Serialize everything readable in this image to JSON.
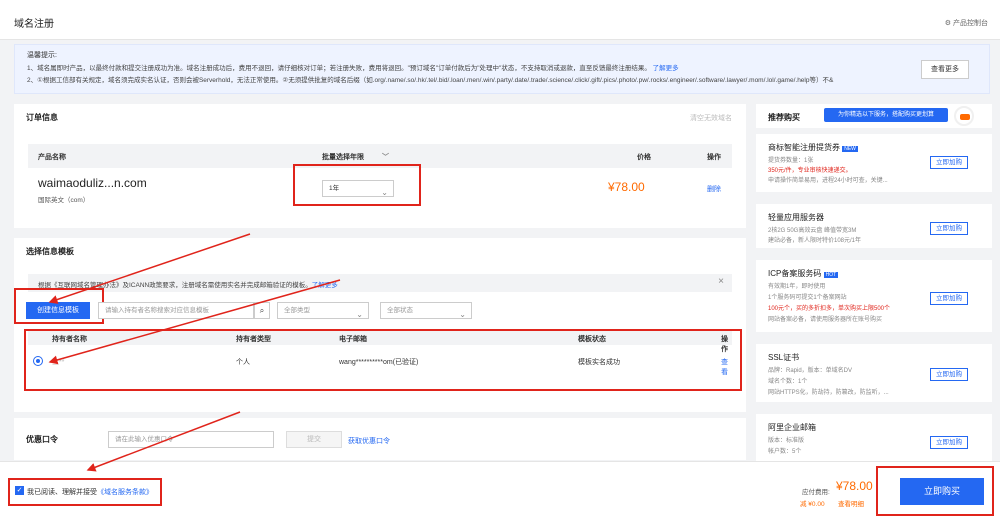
{
  "header": {
    "title": "域名注册",
    "console": "产品控制台"
  },
  "notice": {
    "title": "温馨提示:",
    "line1": "1、域名属即时产品，以最终付款和提交注册成功为准。域名注册成功后，费用不退回，请仔细核对订单；若注册失败，费用将退回。\"预订域名\"订单付款后为\"处理中\"状态，不支持取消或退款，直至反馈最终注册结果。",
    "line1_link": "了解更多",
    "line2": "2、①根据工信部有关规定，域名须完成实名认证，否则会被Serverhold，无法正常使用。②无须提供批复的域名后缀（如.org/.name/.so/.hk/.tel/.bid/.loan/.men/.win/.party/.date/.trade/.science/.click/.gift/.pics/.photo/.pw/.rocks/.engineer/.software/.lawyer/.mom/.lol/.game/.help等）不&",
    "more_button": "查看更多"
  },
  "order": {
    "title": "订单信息",
    "clear": "清空无效域名",
    "col_product": "产品名称",
    "col_years": "批量选择年限",
    "col_price": "价格",
    "col_op": "操作",
    "domain": "waimaoduliz...n.com",
    "domain_type": "国际英文（com）",
    "years": "1年",
    "price": "¥78.00",
    "delete": "删除"
  },
  "template": {
    "title": "选择信息模板",
    "info": "根据《互联网域名管理办法》及ICANN政策要求，注册域名需使用实名并完成邮箱验证的模板。",
    "info_link": "了解更多",
    "create_button": "创建信息模板",
    "search_placeholder": "请输入持有者名称搜索对应信息模板",
    "type_select": "全部类型",
    "status_select": "全部状态",
    "col_holder": "持有者名称",
    "col_type": "持有者类型",
    "col_email": "电子邮箱",
    "col_status": "模板状态",
    "col_op": "操作",
    "row": {
      "holder": "三**",
      "type": "个人",
      "email": "wang**********om(已验证)",
      "status": "模板实名成功",
      "op": "查看"
    }
  },
  "coupon": {
    "title": "优惠口令",
    "placeholder": "请在此输入优惠口令",
    "submit": "提交",
    "get": "获取优惠口令"
  },
  "sidebar": {
    "title": "推荐购买",
    "banner": "为你精选以下服务，搭配购买更划算",
    "items": [
      {
        "name": "商标智能注册提货券",
        "badge": "NEW",
        "d1": "提货券数量：1张",
        "d2": "350元/件，专业审核快速递交。",
        "d3": "申请操作简单易用，进程24小时可查，关键...",
        "button": "立即加购"
      },
      {
        "name": "轻量应用服务器",
        "d1": "2核2G 50G高效云盘 峰值带宽3M",
        "d2": "建站必备，新人限时特价108元/1年",
        "button": "立即加购"
      },
      {
        "name": "ICP备案服务码",
        "badge": "HOT",
        "d1": "有效期1年，即时使用",
        "d2": "1个服务码可提交1个备案网站",
        "d3": "100元个，买的多折扣多，单次购买上限500个",
        "d4": "网站备案必备，请使用服务器所在账号购买",
        "button": "立即加购"
      },
      {
        "name": "SSL证书",
        "d1": "品牌：Rapid，版本：单域名DV",
        "d2": "域名个数：1个",
        "d3": "网站HTTPS化，防劫持，防篡改，防监听，...",
        "button": "立即加购"
      },
      {
        "name": "阿里企业邮箱",
        "d1": "版本：标准版",
        "d2": "帐户数：5个",
        "button": "立即加购"
      }
    ]
  },
  "footer": {
    "agree_text": "我已阅读、理解并接受",
    "agree_link": "《域名服务条款》",
    "pay_label": "应付费用:",
    "pay_amount": "¥78.00",
    "discount": "减 ¥0.00",
    "detail": "查看明细",
    "buy_button": "立即购买"
  },
  "colors": {
    "primary": "#2468f2",
    "price": "#ff6a00",
    "annotation": "#e0241b"
  }
}
